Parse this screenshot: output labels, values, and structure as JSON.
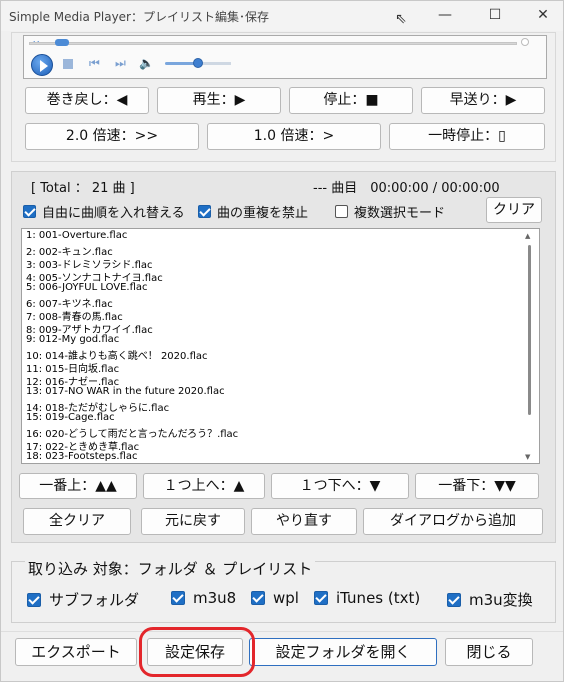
{
  "window": {
    "title": "Simple Media Player：プレイリスト編集･保存",
    "minimize": "—",
    "maximize": "☐",
    "close": "✕"
  },
  "player": {
    "controls": [
      "⏮",
      "⏭"
    ],
    "speaker": "🔈",
    "seek_marker": "◂◂"
  },
  "buttons_row1": [
    "巻き戻し：◀",
    "再生：▶",
    "停止：■",
    "早送り：▶"
  ],
  "buttons_row2": [
    "2.0 倍速：>>",
    "1.0 倍速：>",
    "一時停止：▯"
  ],
  "playlist": {
    "total": "[ Total ： 21 曲 ]",
    "status": "--- 曲目　00:00:00 / 00:00:00",
    "opt_shuffle": "自由に曲順を入れ替える",
    "opt_no_dup": "曲の重複を禁止",
    "opt_multi": "複数選択モード",
    "clear": "クリア",
    "items": [
      "1: 001-Overture.flac",
      "2: 002-キュン.flac",
      "3: 003-ドレミソラシド.flac",
      "4: 005-ソンナコトナイヨ.flac",
      "5: 006-JOYFUL LOVE.flac",
      "6: 007-キツネ.flac",
      "7: 008-青春の馬.flac",
      "8: 009-アザトカワイイ.flac",
      "9: 012-My god.flac",
      "10: 014-誰よりも高く跳べ！ 2020.flac",
      "11: 015-日向坂.flac",
      "12: 016-ナゼー.flac",
      "13: 017-NO WAR in the future 2020.flac",
      "14: 018-ただがむしゃらに.flac",
      "15: 019-Cage.flac",
      "16: 020-どうして雨だと言ったんだろう？.flac",
      "17: 022-ときめき草.flac",
      "18: 023-Footsteps.flac"
    ]
  },
  "move_buttons": [
    "一番上：▲▲",
    "１つ上へ：▲",
    "１つ下へ：▼",
    "一番下：▼▼"
  ],
  "edit_buttons": [
    "全クリア",
    "元に戻す",
    "やり直す",
    "ダイアログから追加"
  ],
  "import": {
    "title": "取り込み 対象：フォルダ ＆ プレイリスト",
    "options": [
      "サブフォルダ",
      "m3u8",
      "wpl",
      "iTunes (txt)",
      "m3u変換"
    ]
  },
  "footer": {
    "export": "エクスポート",
    "save": "設定保存",
    "open_folder": "設定フォルダを開く",
    "close": "閉じる"
  },
  "colors": {
    "accent": "#1f6fc5",
    "highlight": "#e3262b"
  }
}
